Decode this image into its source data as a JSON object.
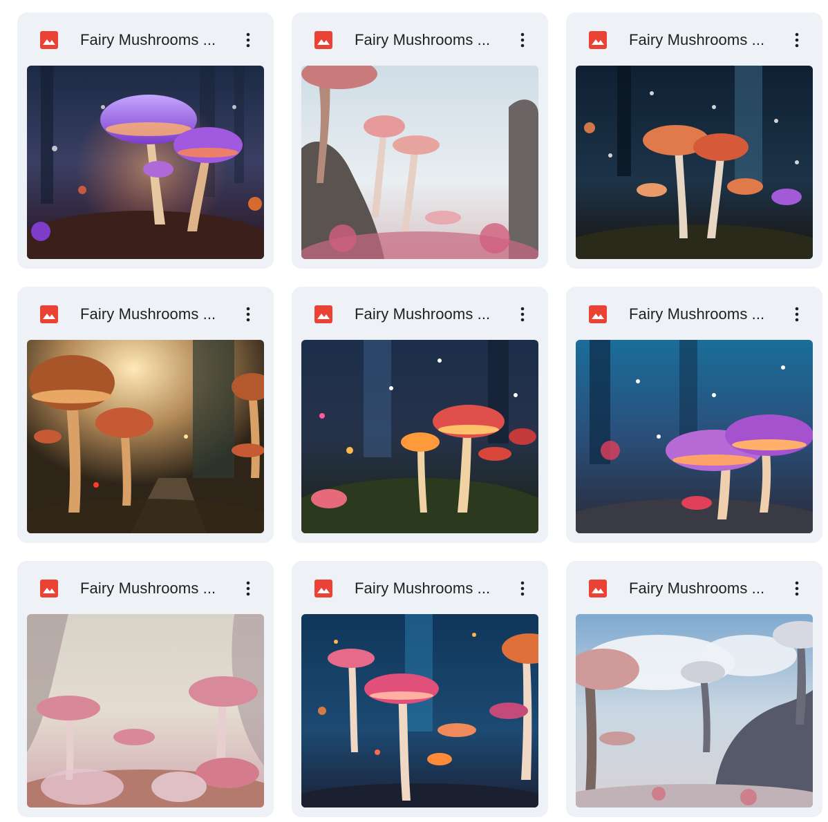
{
  "files": [
    {
      "title": "Fairy Mushrooms ...",
      "icon": "image-file-icon",
      "menu_icon": "more-vert-icon",
      "scene": "purple-glow-forest"
    },
    {
      "title": "Fairy Mushrooms ...",
      "icon": "image-file-icon",
      "menu_icon": "more-vert-icon",
      "scene": "pink-misty-cliffs"
    },
    {
      "title": "Fairy Mushrooms ...",
      "icon": "image-file-icon",
      "menu_icon": "more-vert-icon",
      "scene": "orange-night-forest"
    },
    {
      "title": "Fairy Mushrooms ...",
      "icon": "image-file-icon",
      "menu_icon": "more-vert-icon",
      "scene": "golden-path-forest"
    },
    {
      "title": "Fairy Mushrooms ...",
      "icon": "image-file-icon",
      "menu_icon": "more-vert-icon",
      "scene": "glowing-meadow"
    },
    {
      "title": "Fairy Mushrooms ...",
      "icon": "image-file-icon",
      "menu_icon": "more-vert-icon",
      "scene": "blue-violet-forest"
    },
    {
      "title": "Fairy Mushrooms ...",
      "icon": "image-file-icon",
      "menu_icon": "more-vert-icon",
      "scene": "pastel-pink-valley"
    },
    {
      "title": "Fairy Mushrooms ...",
      "icon": "image-file-icon",
      "menu_icon": "more-vert-icon",
      "scene": "blue-bokeh-mushrooms"
    },
    {
      "title": "Fairy Mushrooms ...",
      "icon": "image-file-icon",
      "menu_icon": "more-vert-icon",
      "scene": "white-sky-giants"
    }
  ],
  "colors": {
    "card_background": "#eef1f6",
    "icon_red": "#ea4335",
    "title_text": "#1f1f1f",
    "menu_dots": "#1f1f1f"
  }
}
